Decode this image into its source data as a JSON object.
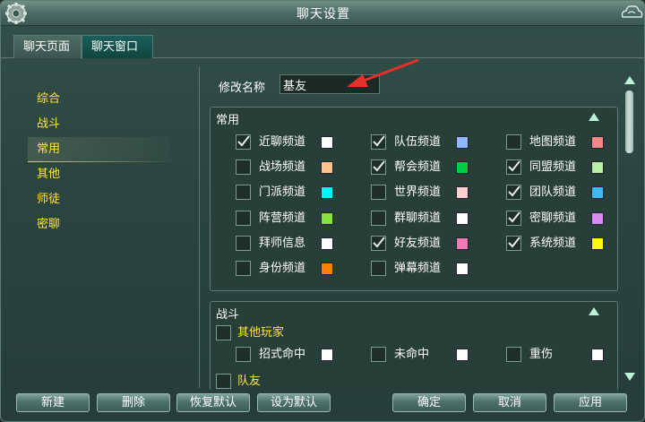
{
  "window": {
    "title": "聊天设置"
  },
  "tabs": [
    {
      "label": "聊天页面",
      "active": false
    },
    {
      "label": "聊天窗口",
      "active": true
    }
  ],
  "sidebar": {
    "items": [
      {
        "label": "综合",
        "active": false
      },
      {
        "label": "战斗",
        "active": false
      },
      {
        "label": "常用",
        "active": true
      },
      {
        "label": "其他",
        "active": false
      },
      {
        "label": "师徒",
        "active": false
      },
      {
        "label": "密聊",
        "active": false
      }
    ]
  },
  "rename": {
    "label": "修改名称",
    "value": "基友"
  },
  "common_group": {
    "title": "常用",
    "options": [
      {
        "label": "近聊频道",
        "checked": true,
        "color": "#ffffff"
      },
      {
        "label": "队伍频道",
        "checked": true,
        "color": "#8fb8ff"
      },
      {
        "label": "地图频道",
        "checked": false,
        "color": "#f48a86"
      },
      {
        "label": "战场频道",
        "checked": false,
        "color": "#ffc58a"
      },
      {
        "label": "帮会频道",
        "checked": true,
        "color": "#00cc44"
      },
      {
        "label": "同盟频道",
        "checked": true,
        "color": "#b8f0a8"
      },
      {
        "label": "门派频道",
        "checked": false,
        "color": "#00f5f5"
      },
      {
        "label": "世界频道",
        "checked": false,
        "color": "#ffd0d0"
      },
      {
        "label": "团队频道",
        "checked": true,
        "color": "#3db8f0"
      },
      {
        "label": "阵营频道",
        "checked": false,
        "color": "#88e040"
      },
      {
        "label": "群聊频道",
        "checked": false,
        "color": "#ffffff"
      },
      {
        "label": "密聊频道",
        "checked": true,
        "color": "#d88af5"
      },
      {
        "label": "拜师信息",
        "checked": false,
        "color": "#ffffff"
      },
      {
        "label": "好友频道",
        "checked": true,
        "color": "#f07ab8"
      },
      {
        "label": "系统频道",
        "checked": true,
        "color": "#ffff00"
      },
      {
        "label": "身份频道",
        "checked": false,
        "color": "#ff8000"
      },
      {
        "label": "弹幕频道",
        "checked": false,
        "color": "#ffffff"
      }
    ]
  },
  "combat_group": {
    "title": "战斗",
    "sub_other": {
      "label": "其他玩家",
      "checked": false
    },
    "options": [
      {
        "label": "招式命中",
        "checked": false,
        "color": "#ffffff"
      },
      {
        "label": "未命中",
        "checked": false,
        "color": "#ffffff"
      },
      {
        "label": "重伤",
        "checked": false,
        "color": "#ffffff"
      }
    ],
    "sub_team": {
      "label": "队友",
      "checked": false
    }
  },
  "buttons": {
    "new": "新建",
    "delete": "删除",
    "restore_default": "恢复默认",
    "set_default": "设为默认",
    "ok": "确定",
    "cancel": "取消",
    "apply": "应用"
  },
  "icons": {
    "gear": "gear-icon",
    "close": "cloud-close-icon",
    "check": "check-icon",
    "collapse": "triangle-up-icon",
    "annotation": "red-arrow-icon"
  }
}
